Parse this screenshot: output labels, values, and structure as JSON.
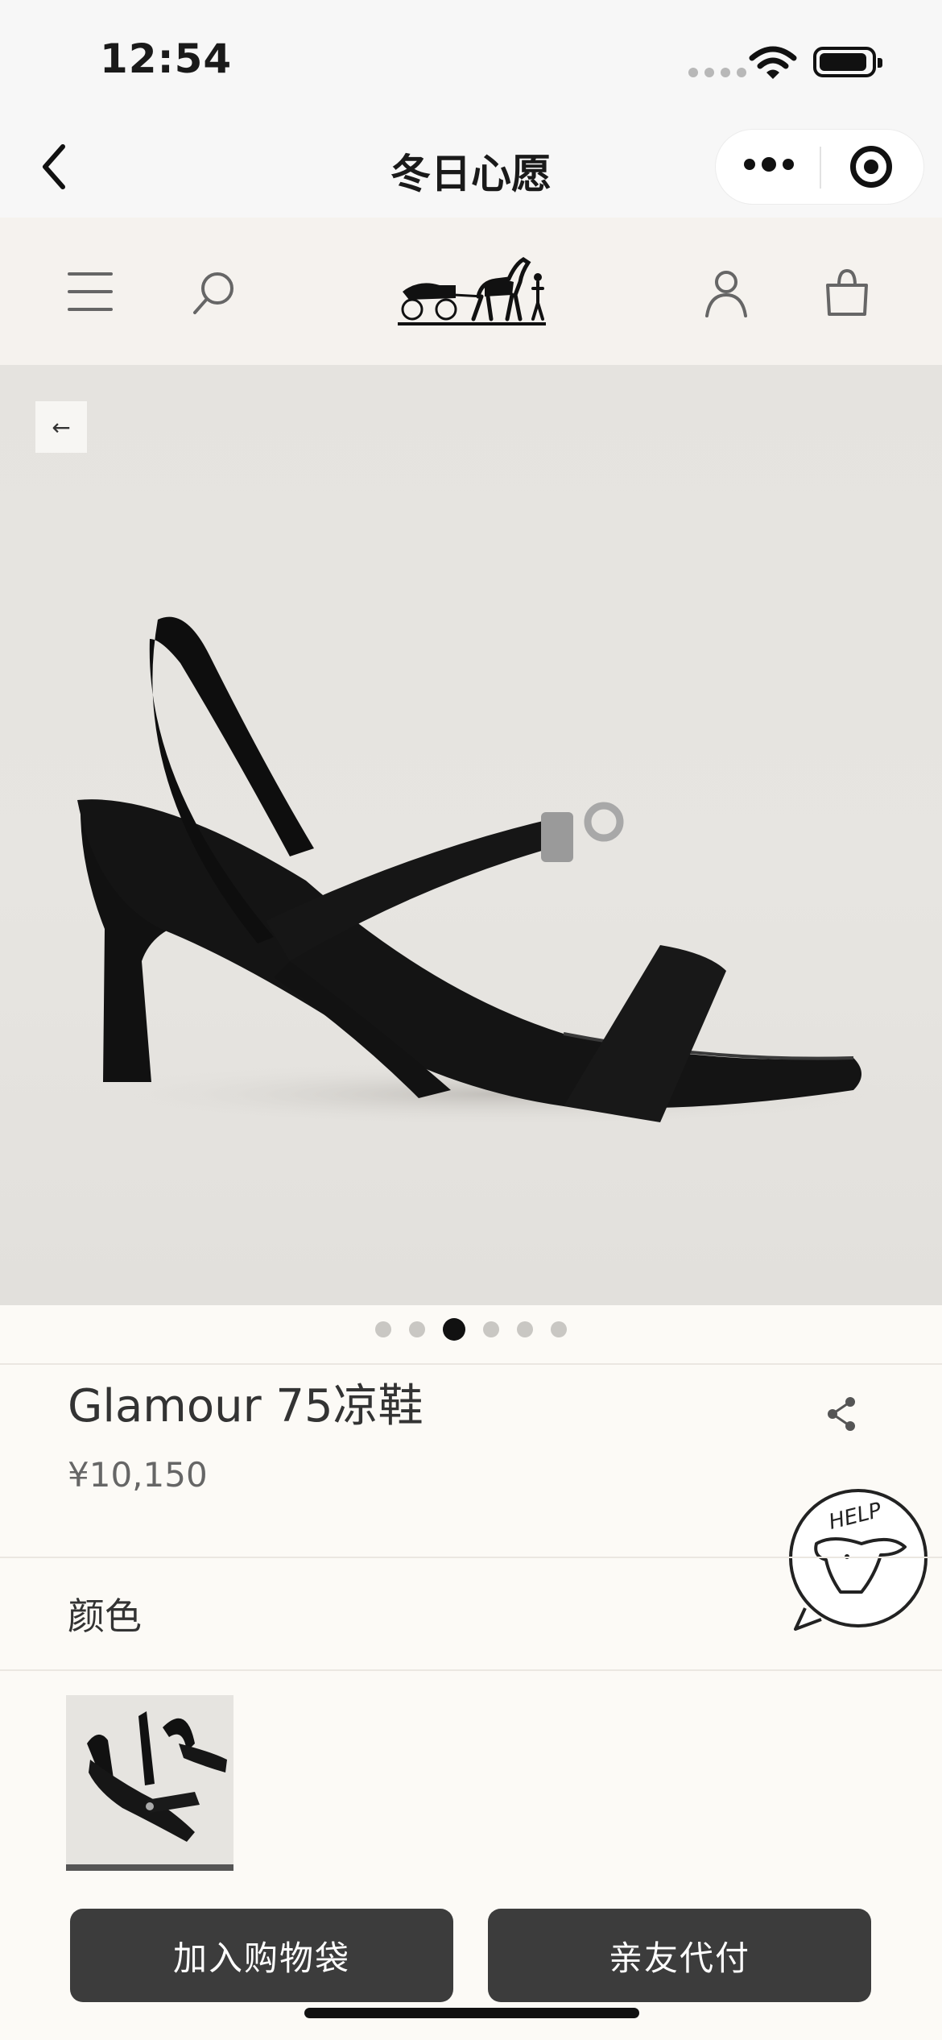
{
  "status_bar": {
    "time": "12:54"
  },
  "nav": {
    "title": "冬日心愿"
  },
  "product": {
    "name": "Glamour 75凉鞋",
    "price": "¥10,150",
    "color_label": "颜色",
    "image_count": 6,
    "active_image_index": 2
  },
  "help": {
    "badge_text": "HELP"
  },
  "actions": {
    "add_to_cart": "加入购物袋",
    "friend_pay": "亲友代付"
  },
  "colors": {
    "button_bg": "#3c3c3c",
    "page_bg": "#fcfaf6",
    "header_bg": "#f5f2ee"
  }
}
